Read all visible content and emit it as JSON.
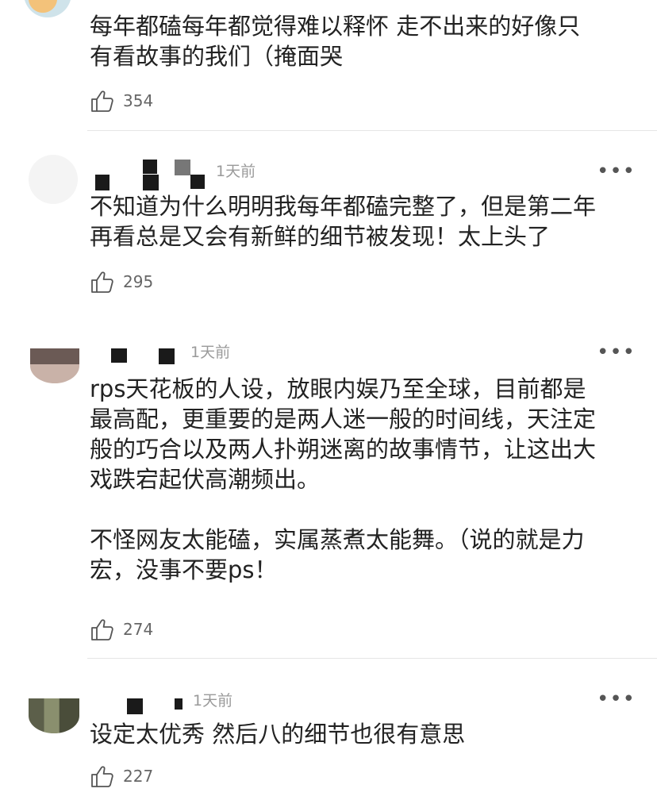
{
  "comments": [
    {
      "time": "",
      "text": "每年都磕每年都觉得难以释怀 走不出来的好像只\n有看故事的我们（掩面哭",
      "likes": "354"
    },
    {
      "time": "1天前",
      "text": "不知道为什么明明我每年都磕完整了，但是第二年\n再看总是又会有新鲜的细节被发现！太上头了",
      "likes": "295"
    },
    {
      "time": "1天前",
      "text": "rps天花板的人设，放眼内娱乃至全球，目前都是\n最高配，更重要的是两人迷一般的时间线，天注定\n般的巧合以及两人扑朔迷离的故事情节，让这出大\n戏跌宕起伏高潮频出。\n\n不怪网友太能磕，实属蒸煮太能舞。（说的就是力\n宏，没事不要ps！",
      "likes": "274"
    },
    {
      "time": "1天前",
      "text": "设定太优秀 然后八的细节也很有意思",
      "likes": "227"
    }
  ],
  "icons": {
    "like": "thumbs-up-icon",
    "more": "more-dots-icon",
    "avatar": "avatar"
  },
  "colors": {
    "text": "#222222",
    "meta": "#9a9a9a",
    "divider": "#e6e6e6"
  }
}
